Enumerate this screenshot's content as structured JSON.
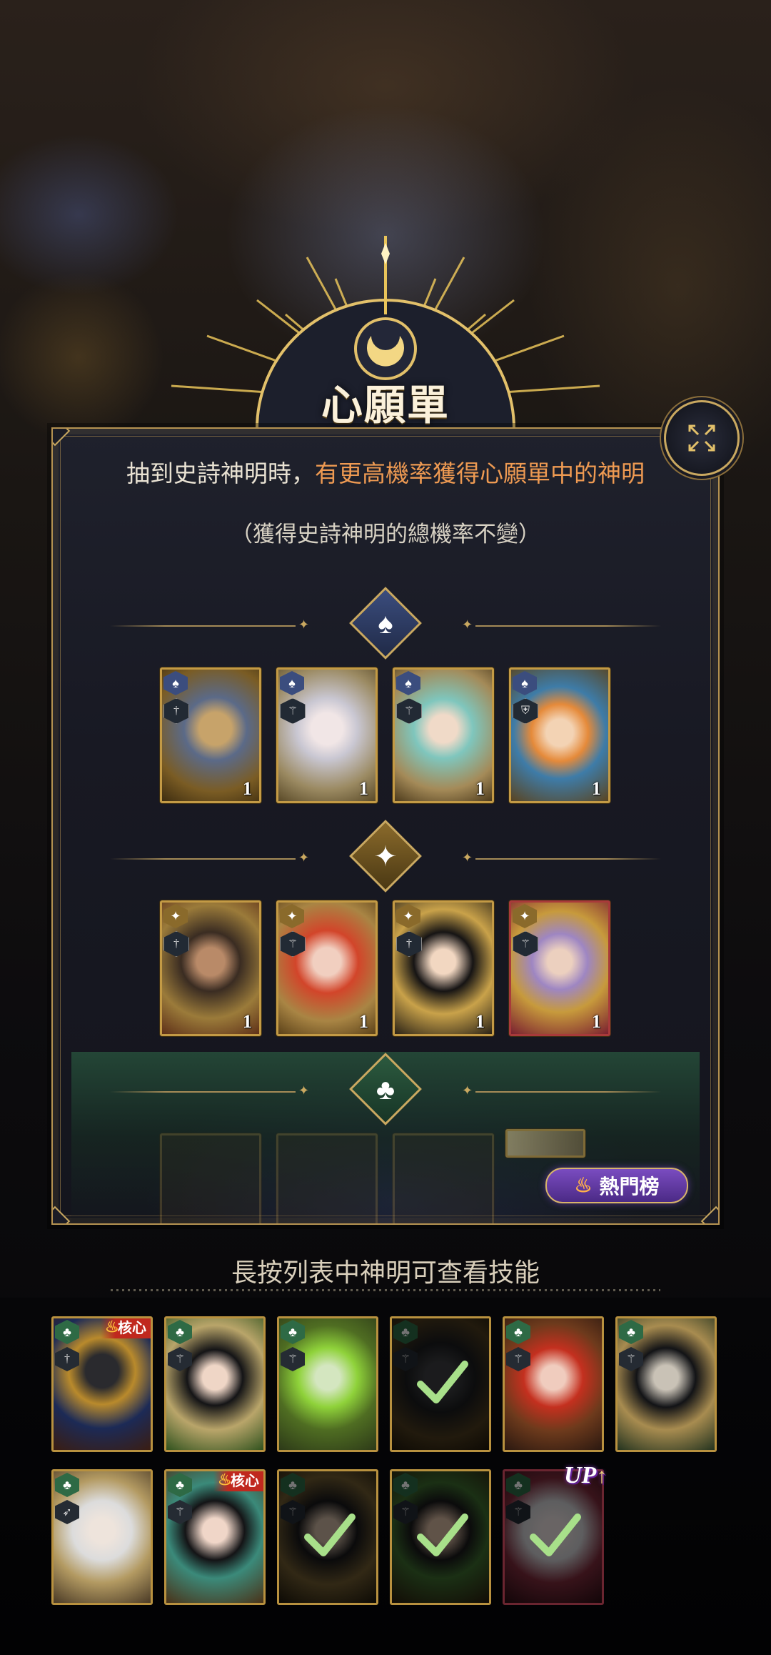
{
  "title": "心願單",
  "description": {
    "prefix": "抽到史詩神明時，",
    "highlight": "有更高機率獲得心願單中的神明",
    "note": "（獲得史詩神明的總機率不變）"
  },
  "hot_button": {
    "label": "熱門榜"
  },
  "hint": "長按列表中神明可查看技能",
  "colors": {
    "accent_gold": "#c9a860",
    "highlight_orange": "#ee9a52",
    "spade_blue": "#3b4d7e",
    "diamond_gold": "#8a6a2b",
    "club_green": "#2e6a45"
  },
  "wish_groups": [
    {
      "suit": "spade-icon",
      "slots": [
        {
          "count": "1",
          "portrait": "bearded-king",
          "role": "sword"
        },
        {
          "count": "1",
          "portrait": "silver-queen",
          "role": "staff"
        },
        {
          "count": "1",
          "portrait": "aqua-elf",
          "role": "staff"
        },
        {
          "count": "1",
          "portrait": "orange-prince",
          "role": "shield"
        }
      ]
    },
    {
      "suit": "diamond-icon",
      "slots": [
        {
          "count": "1",
          "portrait": "dark-warrior",
          "role": "sword"
        },
        {
          "count": "1",
          "portrait": "red-hair-goddess",
          "role": "staff"
        },
        {
          "count": "1",
          "portrait": "black-hair-maiden",
          "role": "sword"
        },
        {
          "count": "1",
          "portrait": "violet-valkyrie",
          "role": "staff"
        }
      ]
    },
    {
      "suit": "club-icon",
      "slots": []
    }
  ],
  "roster": [
    {
      "name": "anubis",
      "core": "核心",
      "selected": false
    },
    {
      "name": "flower-sleeper",
      "core": "",
      "selected": false
    },
    {
      "name": "green-medusa",
      "core": "",
      "selected": false
    },
    {
      "name": "shadow-beast",
      "core": "",
      "selected": true
    },
    {
      "name": "red-sorceress",
      "core": "",
      "selected": false
    },
    {
      "name": "dragon-helm",
      "core": "",
      "selected": false
    },
    {
      "name": "white-elf",
      "core": "",
      "selected": false
    },
    {
      "name": "jade-lady",
      "core": "核心",
      "selected": false
    },
    {
      "name": "black-nymph",
      "core": "",
      "selected": true
    },
    {
      "name": "dark-seer",
      "core": "",
      "selected": true
    },
    {
      "name": "white-witch",
      "core": "",
      "selected": true
    }
  ],
  "up_tag": "UP"
}
